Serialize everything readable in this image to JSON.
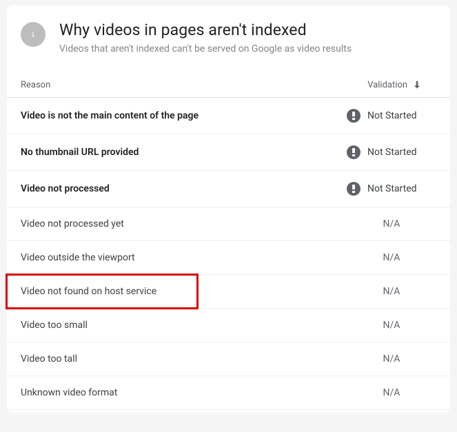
{
  "header": {
    "title": "Why videos in pages aren't indexed",
    "subtitle": "Videos that aren't indexed can't be served on Google as video results"
  },
  "columns": {
    "reason": "Reason",
    "validation": "Validation"
  },
  "status_labels": {
    "not_started": "Not Started",
    "na": "N/A"
  },
  "rows": [
    {
      "reason": "Video is not the main content of the page",
      "status": "not_started",
      "strong": true
    },
    {
      "reason": "No thumbnail URL provided",
      "status": "not_started",
      "strong": true
    },
    {
      "reason": "Video not processed",
      "status": "not_started",
      "strong": true
    },
    {
      "reason": "Video not processed yet",
      "status": "na",
      "strong": false
    },
    {
      "reason": "Video outside the viewport",
      "status": "na",
      "strong": false
    },
    {
      "reason": "Video not found on host service",
      "status": "na",
      "strong": false,
      "highlighted": true
    },
    {
      "reason": "Video too small",
      "status": "na",
      "strong": false
    },
    {
      "reason": "Video too tall",
      "status": "na",
      "strong": false
    },
    {
      "reason": "Unknown video format",
      "status": "na",
      "strong": false
    }
  ]
}
